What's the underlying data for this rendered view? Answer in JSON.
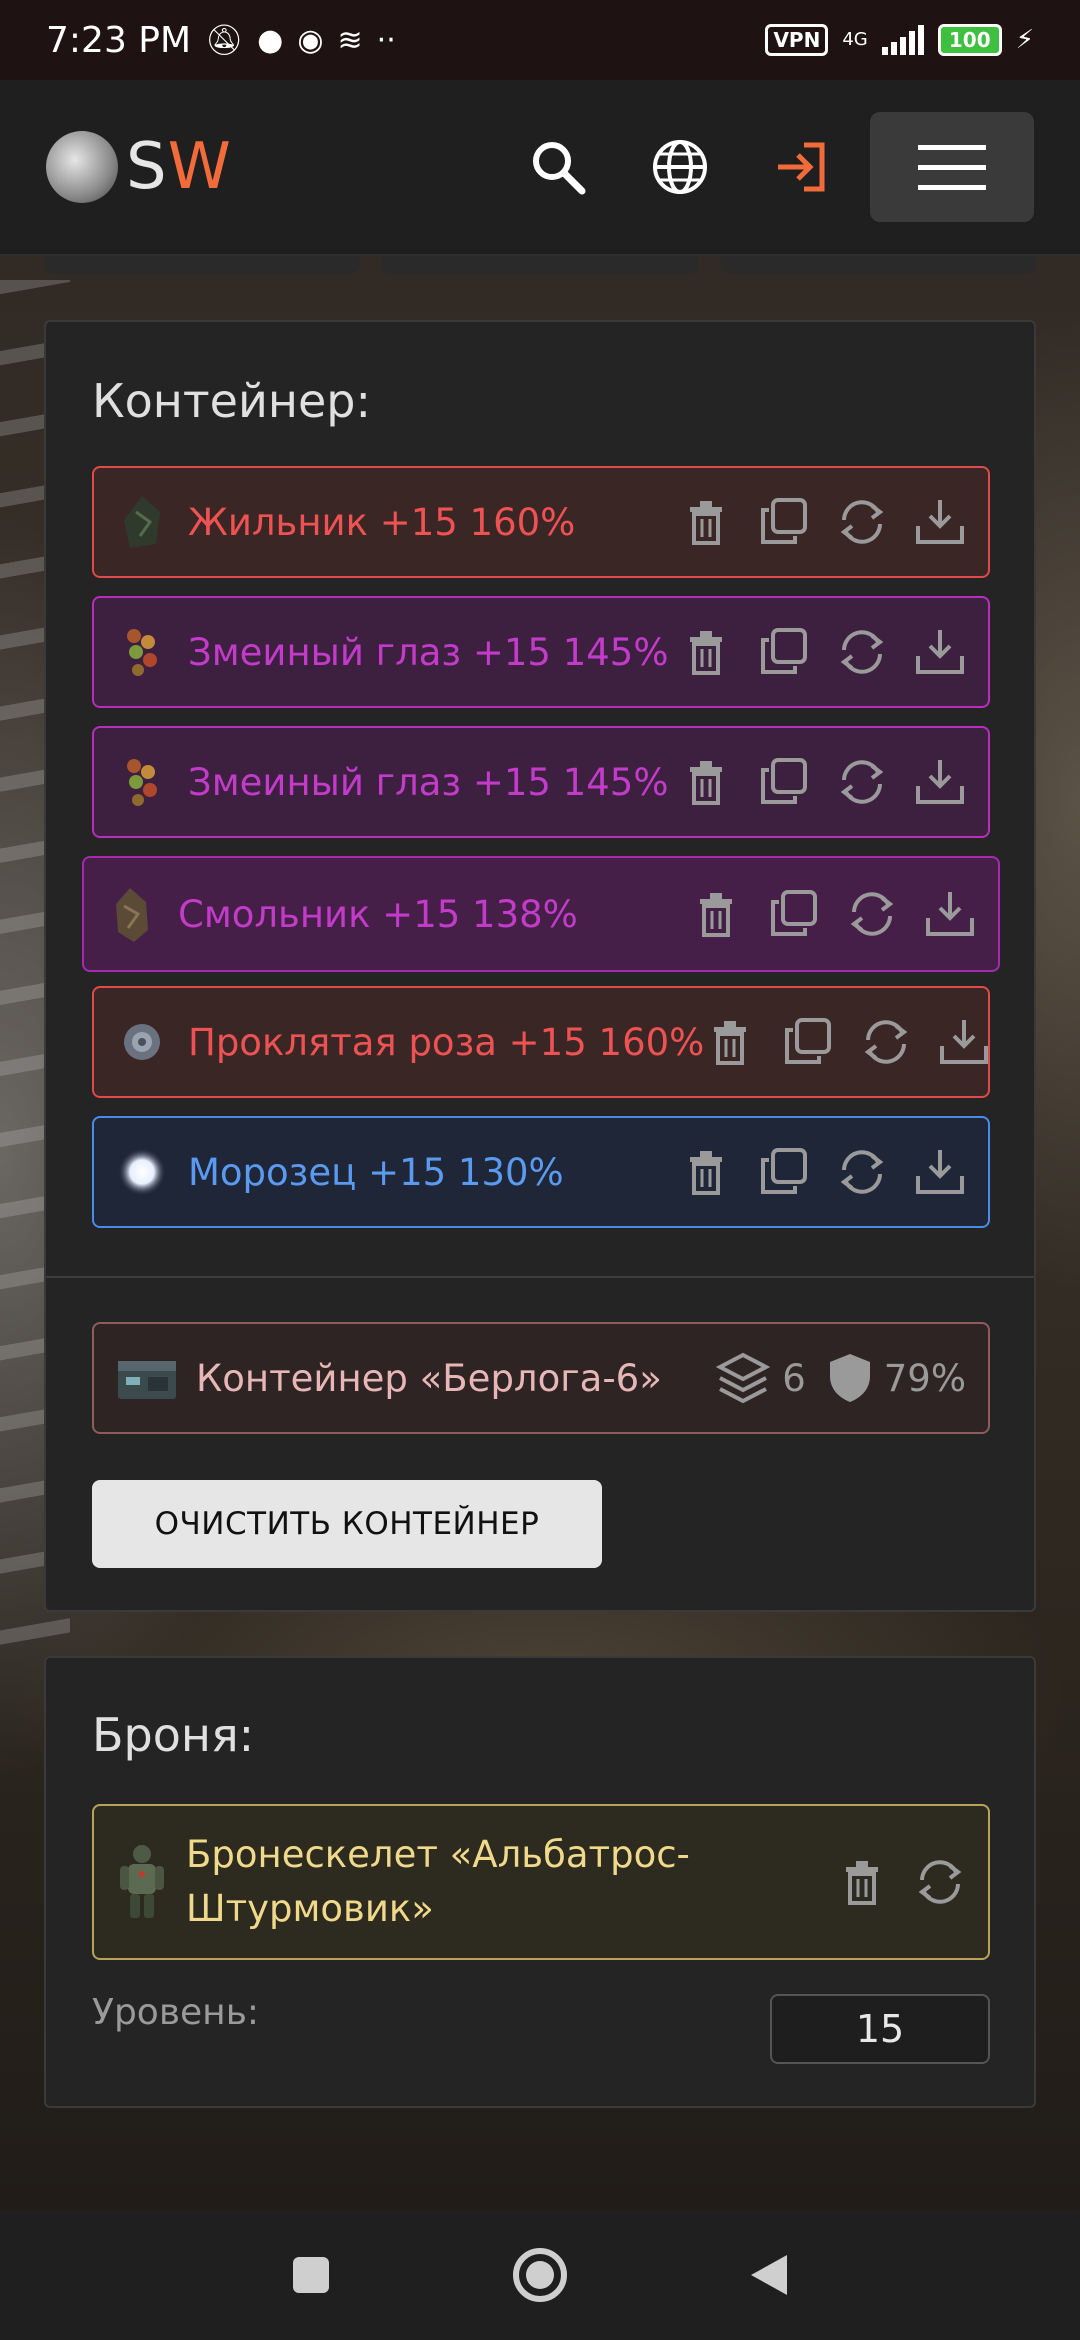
{
  "status_bar": {
    "time": "7:23 PM",
    "vpn": "VPN",
    "network": "4G",
    "battery": "100"
  },
  "header": {
    "logo_s": "S",
    "logo_w": "W"
  },
  "container_panel": {
    "title": "Контейнер:",
    "items": [
      {
        "name": "Жильник +15 160%",
        "color": "red"
      },
      {
        "name": "Змеиный глаз +15 145%",
        "color": "purple"
      },
      {
        "name": "Змеиный глаз +15 145%",
        "color": "purple"
      },
      {
        "name": "Смольник +15 138%",
        "color": "purple"
      },
      {
        "name": "Проклятая роза +15 160%",
        "color": "red"
      },
      {
        "name": "Морозец +15 130%",
        "color": "blue"
      }
    ],
    "container": {
      "name": "Контейнер «Берлога-6»",
      "slots": "6",
      "protection": "79%"
    },
    "clear_button": "ОЧИСТИТЬ КОНТЕЙНЕР"
  },
  "armor_panel": {
    "title": "Броня:",
    "armor_line1": "Бронескелет «Альбатрос-",
    "armor_line2": "Штурмовик»",
    "level_label": "Уровень:",
    "level_value": "15"
  },
  "colors": {
    "accent_orange": "#f26b3a",
    "rarity_red": "#ef5252",
    "rarity_purple": "#c23bc9",
    "rarity_blue": "#5a9af0",
    "rarity_gold": "#f0d98a"
  }
}
